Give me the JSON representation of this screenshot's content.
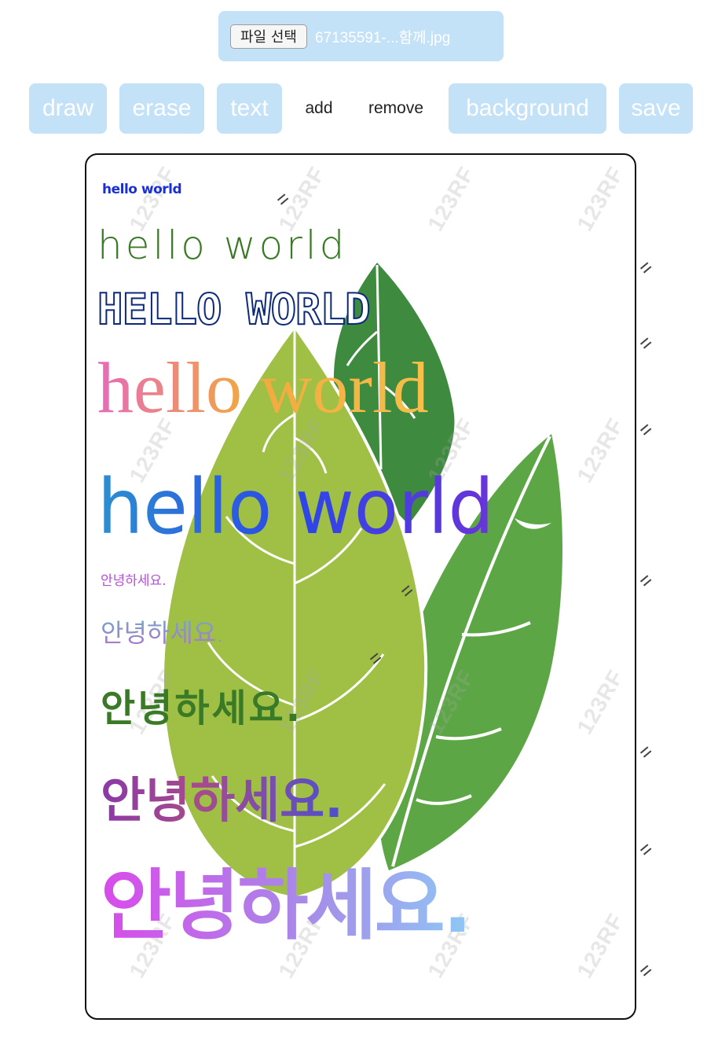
{
  "file_bar": {
    "button_label": "파일 선택",
    "file_name": "67135591-...함께.jpg"
  },
  "toolbar": {
    "draw": "draw",
    "erase": "erase",
    "text": "text",
    "add": "add",
    "remove": "remove",
    "background": "background",
    "save": "save"
  },
  "canvas": {
    "watermark": "123RF",
    "texts": [
      {
        "text": "hello world"
      },
      {
        "text": "hello world"
      },
      {
        "text": "HELLO WORLD"
      },
      {
        "text": "hello world"
      },
      {
        "text": "hello world"
      },
      {
        "text": "안녕하세요."
      },
      {
        "text": "안녕하세요."
      },
      {
        "text": "안녕하세요."
      },
      {
        "text": "안녕하세요."
      },
      {
        "text": "안녕하세요."
      }
    ]
  },
  "colors": {
    "toolbar_bg": "#c3e1f7",
    "leaf_light": "#9fbf45",
    "leaf_mid": "#5ca646",
    "leaf_dark": "#3e8a3f"
  }
}
